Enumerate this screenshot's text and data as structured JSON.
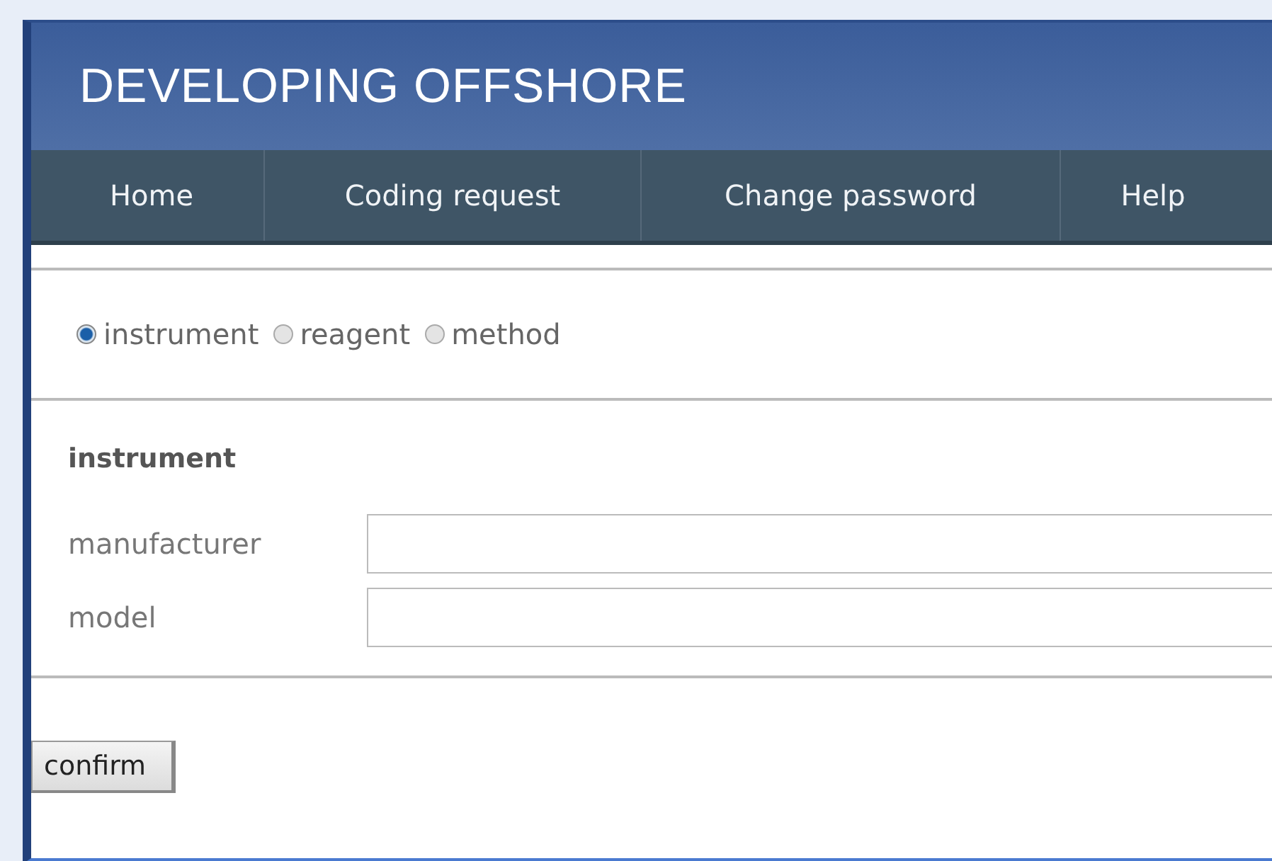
{
  "header": {
    "title": "DEVELOPING OFFSHORE"
  },
  "nav": [
    {
      "label": "Home"
    },
    {
      "label": "Coding request"
    },
    {
      "label": "Change password"
    },
    {
      "label": "Help"
    }
  ],
  "types": [
    {
      "label": "instrument",
      "selected": true
    },
    {
      "label": "reagent",
      "selected": false
    },
    {
      "label": "method",
      "selected": false
    }
  ],
  "section": {
    "title": "instrument"
  },
  "fields": [
    {
      "label": "manufacturer"
    },
    {
      "label": "model"
    }
  ],
  "confirm": "confirm"
}
